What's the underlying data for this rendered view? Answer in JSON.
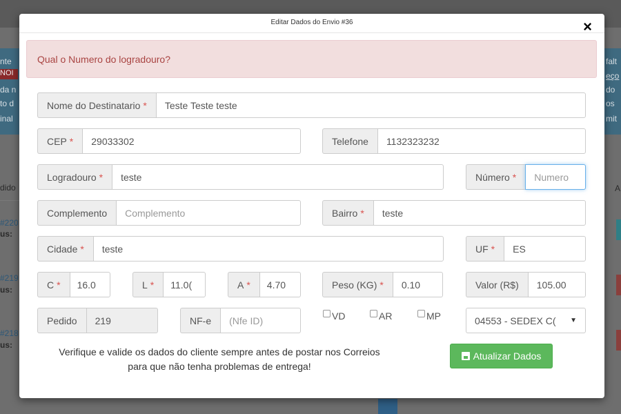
{
  "background": {
    "left_fragments": [
      "nte",
      "NOI",
      "da n",
      "to d",
      "inal",
      "dido",
      "#220",
      "us:",
      "#219",
      "us:",
      "#218",
      "us:"
    ],
    "right_fragments": [
      "falt",
      "eço",
      "do",
      "os",
      "mit",
      "A"
    ]
  },
  "modal": {
    "title": "Editar Dados do Envio #36",
    "close_icon": "×"
  },
  "alert": {
    "message": "Qual o Numero do logradouro?"
  },
  "form": {
    "destinatario": {
      "label": "Nome do Destinatario",
      "required": "*",
      "value": "Teste Teste teste"
    },
    "cep": {
      "label": "CEP",
      "required": "*",
      "value": "29033302"
    },
    "telefone": {
      "label": "Telefone",
      "value": "1132323232"
    },
    "logradouro": {
      "label": "Logradouro",
      "required": "*",
      "value": "teste"
    },
    "numero": {
      "label": "Número",
      "required": "*",
      "value": "",
      "placeholder": "Numero"
    },
    "complemento": {
      "label": "Complemento",
      "value": "",
      "placeholder": "Complemento"
    },
    "bairro": {
      "label": "Bairro",
      "required": "*",
      "value": "teste"
    },
    "cidade": {
      "label": "Cidade",
      "required": "*",
      "value": "teste"
    },
    "uf": {
      "label": "UF",
      "required": "*",
      "value": "ES"
    },
    "c": {
      "label": "C",
      "required": "*",
      "value": "16.0"
    },
    "l": {
      "label": "L",
      "required": "*",
      "value": "11.0("
    },
    "a": {
      "label": "A",
      "required": "*",
      "value": "4.70"
    },
    "peso": {
      "label": "Peso (KG)",
      "required": "*",
      "value": "0.10"
    },
    "valor": {
      "label": "Valor (R$)",
      "value": "105.00"
    },
    "pedido": {
      "label": "Pedido",
      "value": "219"
    },
    "nfe": {
      "label": "NF-e",
      "value": "",
      "placeholder": "(Nfe ID)"
    },
    "checkboxes": [
      {
        "label": "VD",
        "checked": false
      },
      {
        "label": "AR",
        "checked": false
      },
      {
        "label": "MP",
        "checked": false
      }
    ],
    "servico": {
      "selected": "04553 - SEDEX C(",
      "caret_icon": "▼"
    }
  },
  "footer": {
    "notice_line1": "Verifique e valide os dados do cliente sempre antes de postar nos Correios",
    "notice_line2": "para que não tenha problemas de entrega!",
    "submit_label": "Atualizar Dados",
    "submit_icon": "save-icon"
  },
  "colors": {
    "alert_bg": "#f2dede",
    "alert_text": "#a94442",
    "required": "#d9534f",
    "submit_bg": "#5cb85c",
    "focus_border": "#66afe9"
  }
}
